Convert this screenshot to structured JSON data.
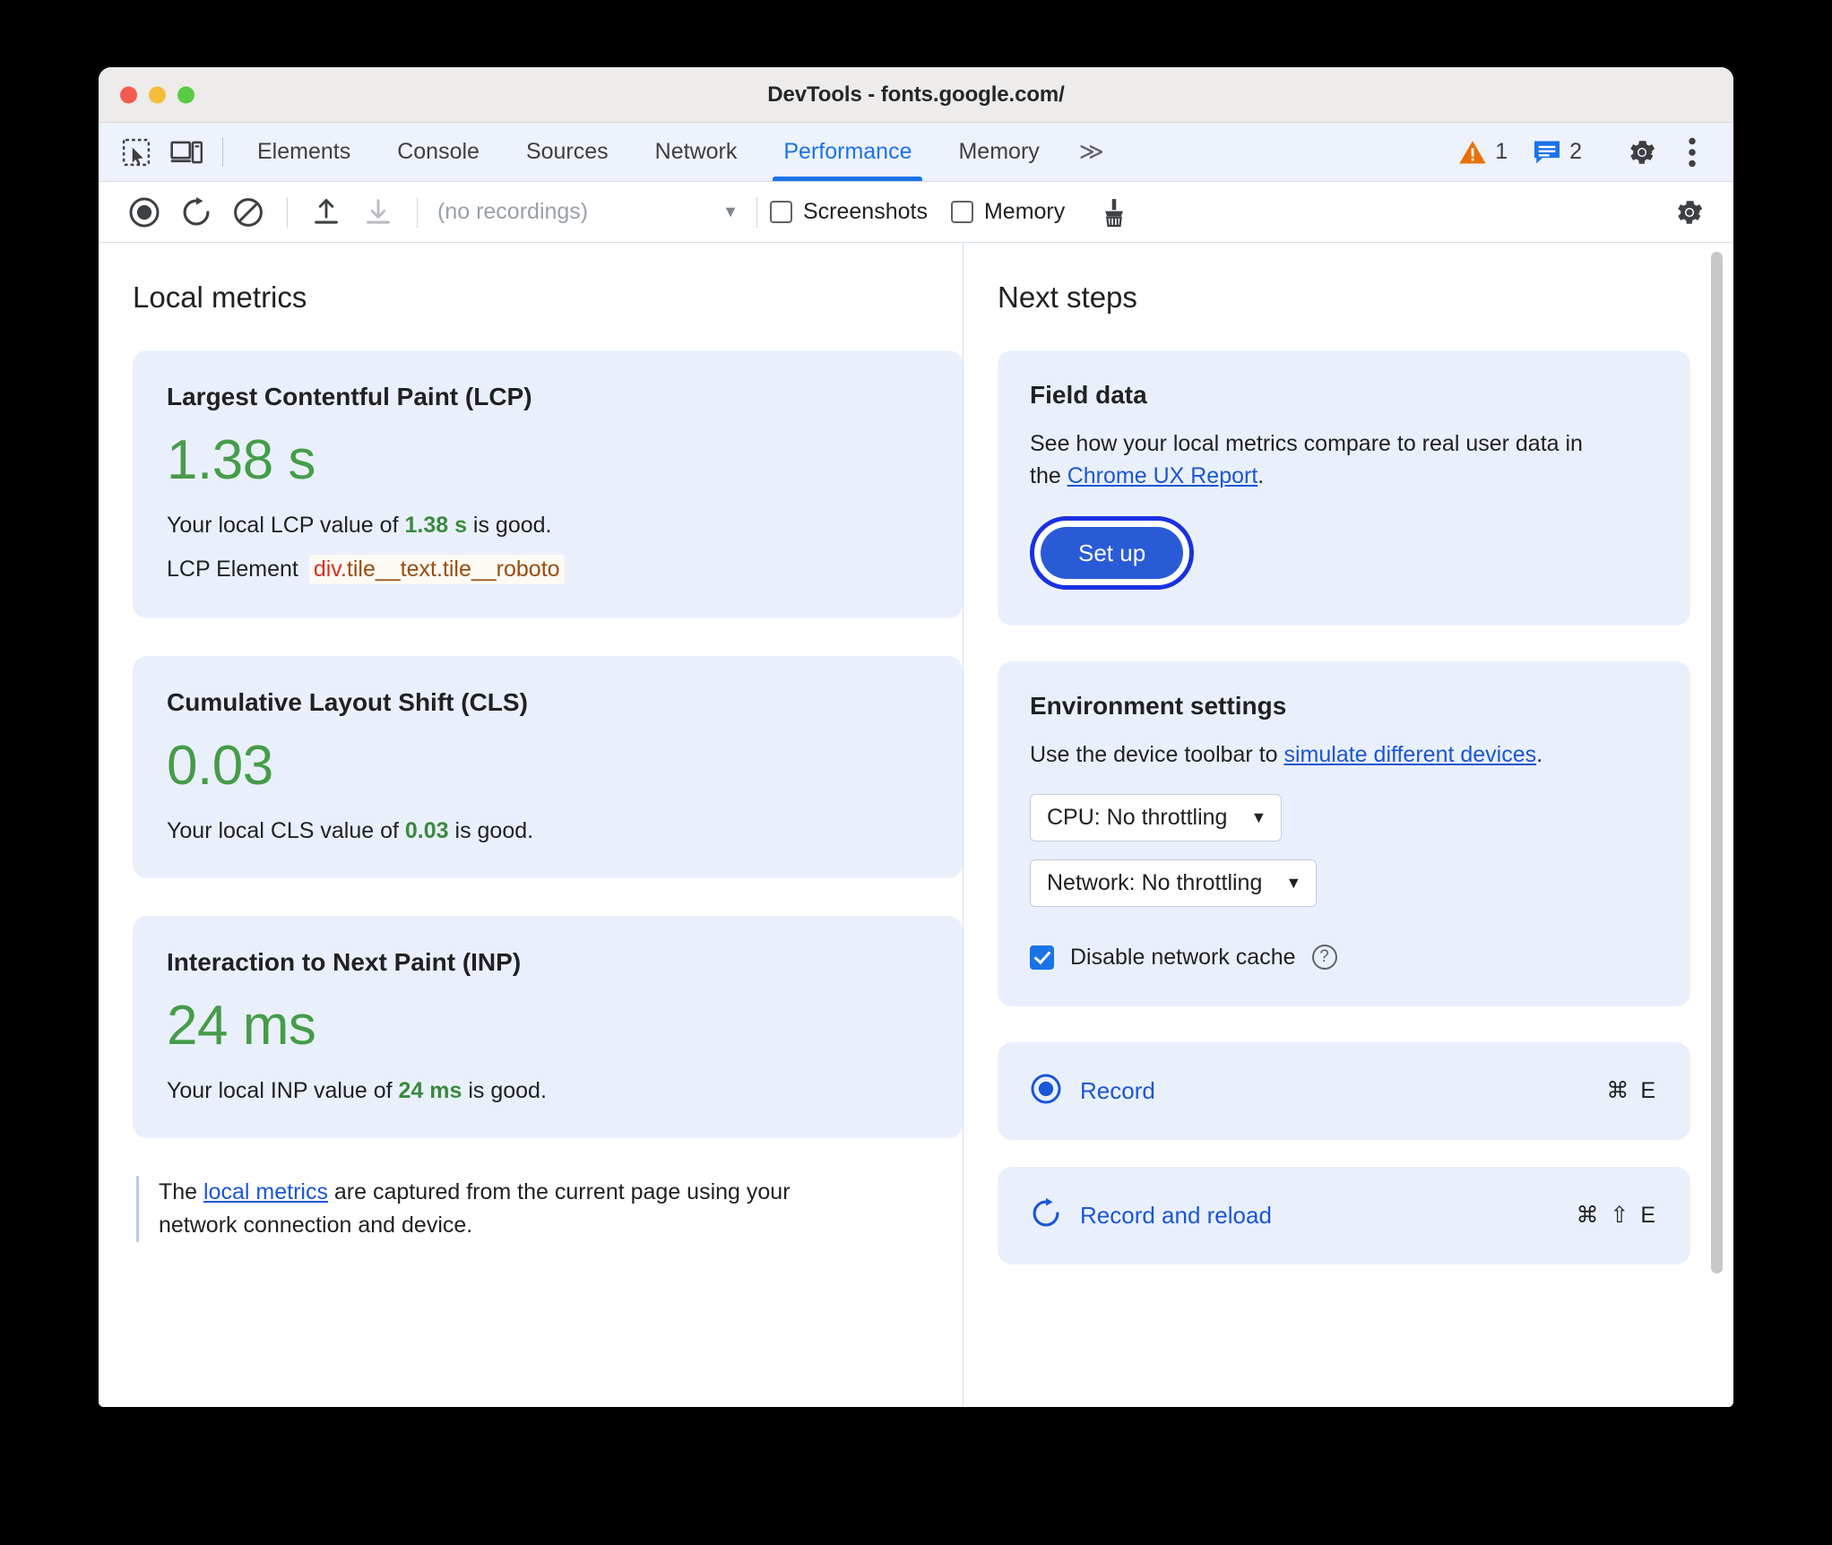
{
  "window": {
    "title": "DevTools - fonts.google.com/",
    "traffic_lights": [
      "close",
      "minimize",
      "maximize"
    ]
  },
  "tabstrip": {
    "inspect_icon": "inspect-element-icon",
    "device_icon": "device-toolbar-icon",
    "tabs": [
      {
        "label": "Elements",
        "active": false
      },
      {
        "label": "Console",
        "active": false
      },
      {
        "label": "Sources",
        "active": false
      },
      {
        "label": "Network",
        "active": false
      },
      {
        "label": "Performance",
        "active": true
      },
      {
        "label": "Memory",
        "active": false
      }
    ],
    "more_tabs_label": "≫",
    "warning_count": "1",
    "issue_count": "2",
    "settings_icon": "gear-icon",
    "more_options_icon": "three-dot-menu-icon"
  },
  "toolbar": {
    "record_icon": "record-icon",
    "record_reload_icon": "reload-record-icon",
    "clear_icon": "clear-icon",
    "upload_icon": "upload-profile-icon",
    "download_icon": "download-profile-icon",
    "recordings_value": "(no recordings)",
    "recordings_caret": "▼",
    "screenshots_label": "Screenshots",
    "screenshots_checked": false,
    "memory_label": "Memory",
    "memory_checked": false,
    "garbage_icon": "collect-garbage-icon",
    "capture_settings_icon": "capture-settings-gear-icon"
  },
  "left_pane": {
    "title": "Local metrics",
    "metrics": [
      {
        "name": "Largest Contentful Paint (LCP)",
        "value": "1.38 s",
        "desc_prefix": "Your local LCP value of ",
        "desc_value": "1.38 s",
        "desc_suffix": " is good.",
        "element_label": "LCP Element",
        "element_tag": "div",
        "element_classes": ".tile__text.tile__roboto"
      },
      {
        "name": "Cumulative Layout Shift (CLS)",
        "value": "0.03",
        "desc_prefix": "Your local CLS value of ",
        "desc_value": "0.03",
        "desc_suffix": " is good."
      },
      {
        "name": "Interaction to Next Paint (INP)",
        "value": "24 ms",
        "desc_prefix": "Your local INP value of ",
        "desc_value": "24 ms",
        "desc_suffix": " is good."
      }
    ],
    "note_prefix": "The ",
    "note_link": "local metrics",
    "note_suffix": " are captured from the current page using your network connection and device."
  },
  "right_pane": {
    "title": "Next steps",
    "field_data": {
      "title": "Field data",
      "text_prefix": "See how your local metrics compare to real user data in the ",
      "link": "Chrome UX Report",
      "text_suffix": ".",
      "button_label": "Set up"
    },
    "environment": {
      "title": "Environment settings",
      "text_prefix": "Use the device toolbar to ",
      "link": "simulate different devices",
      "text_suffix": ".",
      "cpu_select": "CPU: No throttling",
      "network_select": "Network: No throttling",
      "select_caret": "▼",
      "cache_label": "Disable network cache",
      "cache_checked": true,
      "help_glyph": "?"
    },
    "actions": [
      {
        "icon": "record-icon",
        "label": "Record",
        "shortcut": "⌘ E"
      },
      {
        "icon": "reload-record-icon",
        "label": "Record and reload",
        "shortcut": "⌘ ⇧ E"
      }
    ]
  },
  "colors": {
    "accent": "#1a73e8",
    "link": "#1a56d6",
    "good": "#3a8a3f",
    "metric_green": "#469c4a",
    "card_bg": "#eaf0fb",
    "warning": "#e8710a",
    "issue": "#1a73e8",
    "lcp_tag": "#d93025",
    "lcp_class": "#9a4d10",
    "setup_button": "#2a5bd7",
    "focus_ring": "#1a31e0"
  }
}
